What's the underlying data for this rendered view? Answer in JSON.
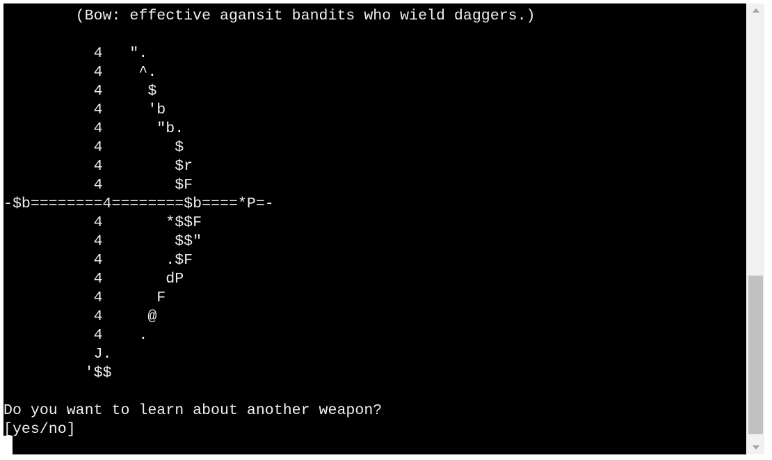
{
  "terminal": {
    "lines": [
      "        (Bow: effective agansit bandits who wield daggers.)",
      "",
      "          4   \".",
      "          4    ^.",
      "          4     $",
      "          4     'b",
      "          4      \"b.",
      "          4        $",
      "          4        $r",
      "          4        $F",
      "-$b========4========$b====*P=-",
      "          4       *$$F",
      "          4        $$\"",
      "          4       .$F",
      "          4       dP",
      "          4      F",
      "          4     @",
      "          4    .",
      "          J.",
      "         '$$",
      "",
      "Do you want to learn about another weapon?",
      "[yes/no]"
    ]
  },
  "colors": {
    "background": "#000000",
    "text": "#f0f0f0",
    "scrollbar_track": "#f1f1f1",
    "scrollbar_thumb": "#c1c1c1"
  },
  "icons": {
    "scroll_up": "triangle-up",
    "scroll_down": "triangle-down"
  }
}
